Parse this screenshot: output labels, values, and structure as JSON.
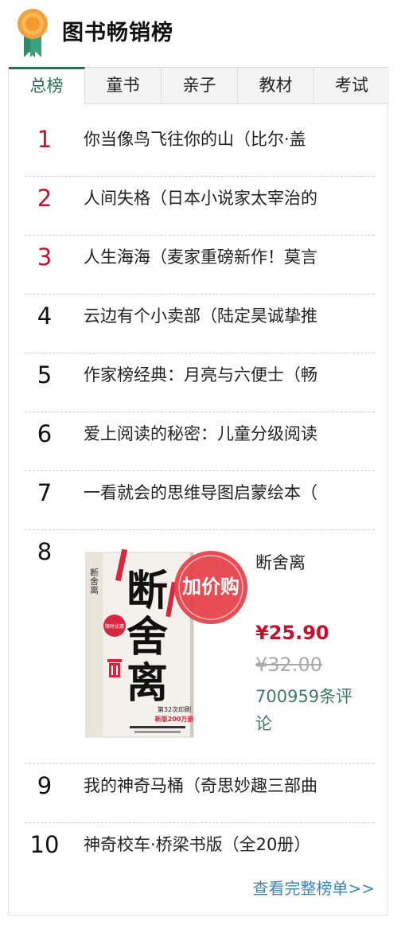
{
  "header": {
    "title": "图书畅销榜",
    "icon": "medal-icon"
  },
  "tabs": [
    {
      "label": "总榜",
      "active": true
    },
    {
      "label": "童书",
      "active": false
    },
    {
      "label": "亲子",
      "active": false
    },
    {
      "label": "教材",
      "active": false
    },
    {
      "label": "考试",
      "active": false
    }
  ],
  "list": [
    {
      "rank": "1",
      "title": "你当像鸟飞往你的山（比尔·盖"
    },
    {
      "rank": "2",
      "title": "人间失格（日本小说家太宰治的"
    },
    {
      "rank": "3",
      "title": "人生海海（麦家重磅新作！莫言"
    },
    {
      "rank": "4",
      "title": "云边有个小卖部（陆定昊诚挚推"
    },
    {
      "rank": "5",
      "title": "作家榜经典：月亮与六便士（畅"
    },
    {
      "rank": "6",
      "title": "爱上阅读的秘密：儿童分级阅读"
    },
    {
      "rank": "7",
      "title": "一看就会的思维导图启蒙绘本（"
    }
  ],
  "featured": {
    "rank": "8",
    "title": "断舍离",
    "price": "¥25.90",
    "original_price": "¥32.00",
    "reviews": "700959条评论",
    "cover": {
      "title_chars": [
        "断",
        "舍",
        "离"
      ],
      "badge": "加价购",
      "spine_text": "断舍离",
      "banner": "第32次印刷",
      "promo": "限时优惠",
      "blurb": "新版200万册"
    }
  },
  "list_tail": [
    {
      "rank": "9",
      "title": "我的神奇马桶（奇思妙趣三部曲"
    },
    {
      "rank": "10",
      "title": "神奇校车·桥梁书版（全20册）"
    }
  ],
  "footer": {
    "more_link": "查看完整榜单>>"
  },
  "colors": {
    "accent_green": "#2e6b52",
    "rank_red": "#c8102e",
    "link_blue": "#3c86b5",
    "review_green": "#3f7a63"
  }
}
